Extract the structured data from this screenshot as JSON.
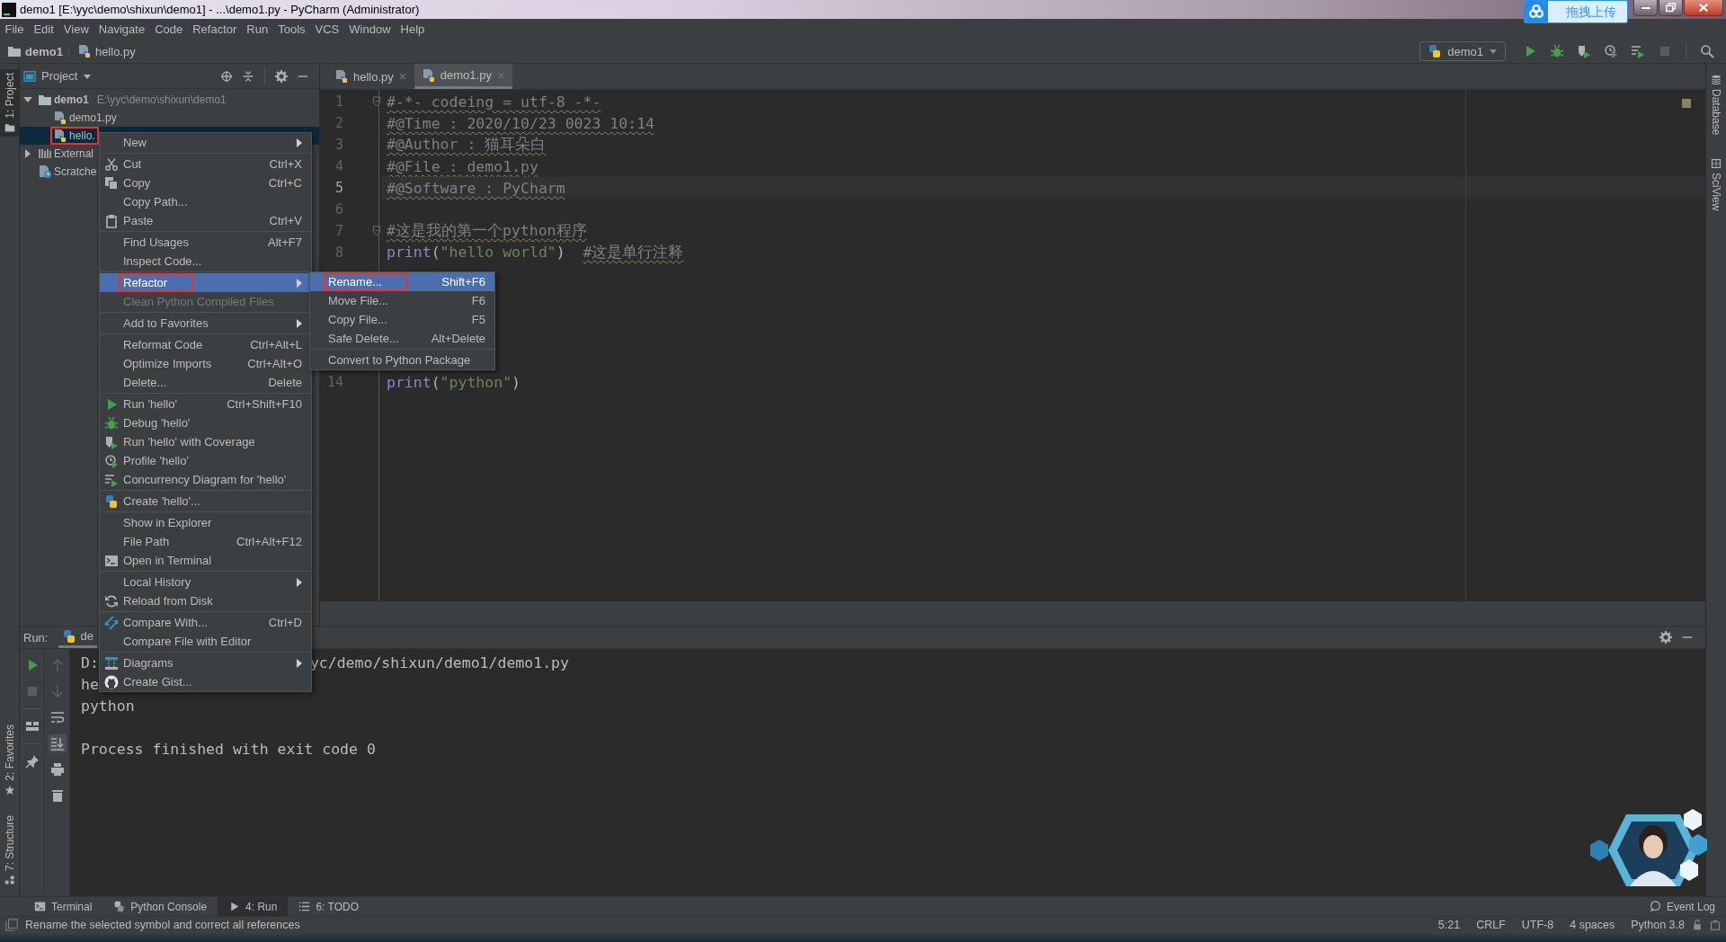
{
  "window": {
    "title": "demo1 [E:\\yyc\\demo\\shixun\\demo1] - ...\\demo1.py - PyCharm (Administrator)",
    "upload_widget": "拖拽上传"
  },
  "menu_bar": [
    "File",
    "Edit",
    "View",
    "Navigate",
    "Code",
    "Refactor",
    "Run",
    "Tools",
    "VCS",
    "Window",
    "Help"
  ],
  "breadcrumbs": [
    {
      "label": "demo1",
      "kind": "folder"
    },
    {
      "label": "hello.py",
      "kind": "python"
    }
  ],
  "run_config": "demo1",
  "left_stripe_top": [
    {
      "label": "1: Project",
      "selected": true
    }
  ],
  "left_stripe_bottom": [
    {
      "label": "2: Favorites",
      "selected": false
    },
    {
      "label": "7: Structure",
      "selected": false
    }
  ],
  "right_stripe": [
    "Database",
    "SciView"
  ],
  "project_panel": {
    "title": "Project",
    "tree": [
      {
        "label": "demo1",
        "path": "E:\\yyc\\demo\\shixun\\demo1",
        "kind": "folder",
        "expanded": true,
        "selected": false,
        "outlined": false,
        "children": [
          {
            "label": "demo1.py",
            "kind": "python",
            "selected": false,
            "outlined": false
          },
          {
            "label": "hello.",
            "kind": "python",
            "selected": true,
            "outlined": true
          }
        ]
      },
      {
        "label": "External",
        "kind": "library",
        "expanded": false,
        "selected": false,
        "outlined": false
      },
      {
        "label": "Scratche",
        "kind": "scratch",
        "selected": false,
        "outlined": false
      }
    ]
  },
  "editor": {
    "tabs": [
      {
        "label": "hello.py",
        "selected": false
      },
      {
        "label": "demo1.py",
        "selected": true
      }
    ],
    "lines": [
      {
        "number": "1",
        "kind": "code",
        "fold": true,
        "current": false,
        "tokens": [
          {
            "kind": "comment",
            "text": "#-*- codeing = utf-8 -*-"
          }
        ]
      },
      {
        "number": "2",
        "kind": "code",
        "fold": false,
        "current": false,
        "tokens": [
          {
            "kind": "comment",
            "text": "#@Time : 2020/10/23 0023 10:14"
          }
        ]
      },
      {
        "number": "3",
        "kind": "code",
        "fold": false,
        "current": false,
        "tokens": [
          {
            "kind": "comment",
            "text": "#@Author : 猫耳朵白"
          }
        ]
      },
      {
        "number": "4",
        "kind": "code",
        "fold": false,
        "current": false,
        "tokens": [
          {
            "kind": "comment",
            "text": "#@File : demo1.py"
          }
        ]
      },
      {
        "number": "5",
        "kind": "code",
        "fold": false,
        "current": true,
        "tokens": [
          {
            "kind": "comment",
            "text": "#@Software : PyCharm"
          }
        ]
      },
      {
        "number": "6",
        "kind": "blank",
        "fold": false,
        "current": false
      },
      {
        "number": "7",
        "kind": "code",
        "fold": true,
        "current": false,
        "tokens": [
          {
            "kind": "comment",
            "text": "#这是我的第一个python程序"
          }
        ]
      },
      {
        "number": "8",
        "kind": "code",
        "fold": false,
        "current": false,
        "tokens": [
          {
            "kind": "builtin",
            "text": "print"
          },
          {
            "kind": "paren",
            "text": "("
          },
          {
            "kind": "string",
            "text": "\"hello world\""
          },
          {
            "kind": "paren",
            "text": ")"
          },
          {
            "kind": "comment",
            "text": "#这是单行注释",
            "spaced": true
          }
        ]
      },
      {
        "kind": "covered"
      },
      {
        "kind": "covered"
      },
      {
        "kind": "covered"
      },
      {
        "kind": "covered"
      },
      {
        "kind": "covered"
      },
      {
        "number": "14",
        "kind": "code",
        "fold": false,
        "current": false,
        "tokens": [
          {
            "kind": "builtin",
            "text": "print"
          },
          {
            "kind": "paren",
            "text": "("
          },
          {
            "kind": "string",
            "text": "\"python\""
          },
          {
            "kind": "paren",
            "text": ")"
          }
        ]
      }
    ]
  },
  "run_panel": {
    "title": "Run:",
    "tab": "de",
    "console": [
      {
        "kind": "text",
        "text": "D:",
        "rest": "yc/demo/shixun/demo1/demo1.py"
      },
      {
        "kind": "text",
        "text": "he"
      },
      {
        "kind": "text",
        "text": "python"
      },
      {
        "kind": "blank"
      },
      {
        "kind": "text",
        "text": "Process finished with exit code 0"
      }
    ]
  },
  "bottom_tabs": [
    {
      "label": "Terminal",
      "selected": false
    },
    {
      "label": "Python Console",
      "selected": false
    },
    {
      "label": "4: Run",
      "selected": true
    },
    {
      "label": "6: TODO",
      "selected": false
    }
  ],
  "event_log": "Event Log",
  "status_bar": {
    "message": "Rename the selected symbol and correct all references",
    "items": [
      "5:21",
      "CRLF",
      "UTF-8",
      "4 spaces",
      "Python 3.8"
    ]
  },
  "context_menu": {
    "items": [
      {
        "kind": "item",
        "label": "New",
        "submenu": true,
        "selected": false,
        "disabled": false,
        "outlined": false
      },
      {
        "kind": "separator"
      },
      {
        "kind": "item",
        "label": "Cut",
        "shortcut": "Ctrl+X",
        "submenu": false,
        "selected": false,
        "disabled": false,
        "outlined": false
      },
      {
        "kind": "item",
        "label": "Copy",
        "shortcut": "Ctrl+C",
        "submenu": false,
        "selected": false,
        "disabled": false,
        "outlined": false
      },
      {
        "kind": "item",
        "label": "Copy Path...",
        "submenu": false,
        "selected": false,
        "disabled": false,
        "outlined": false
      },
      {
        "kind": "item",
        "label": "Paste",
        "shortcut": "Ctrl+V",
        "submenu": false,
        "selected": false,
        "disabled": false,
        "outlined": false
      },
      {
        "kind": "separator"
      },
      {
        "kind": "item",
        "label": "Find Usages",
        "shortcut": "Alt+F7",
        "submenu": false,
        "selected": false,
        "disabled": false,
        "outlined": false
      },
      {
        "kind": "item",
        "label": "Inspect Code...",
        "submenu": false,
        "selected": false,
        "disabled": false,
        "outlined": false
      },
      {
        "kind": "separator"
      },
      {
        "kind": "item",
        "label": "Refactor",
        "submenu": true,
        "selected": true,
        "disabled": false,
        "outlined": true
      },
      {
        "kind": "item",
        "label": "Clean Python Compiled Files",
        "submenu": false,
        "selected": false,
        "disabled": true,
        "outlined": false
      },
      {
        "kind": "separator"
      },
      {
        "kind": "item",
        "label": "Add to Favorites",
        "submenu": true,
        "selected": false,
        "disabled": false,
        "outlined": false
      },
      {
        "kind": "separator"
      },
      {
        "kind": "item",
        "label": "Reformat Code",
        "shortcut": "Ctrl+Alt+L",
        "submenu": false,
        "selected": false,
        "disabled": false,
        "outlined": false
      },
      {
        "kind": "item",
        "label": "Optimize Imports",
        "shortcut": "Ctrl+Alt+O",
        "submenu": false,
        "selected": false,
        "disabled": false,
        "outlined": false
      },
      {
        "kind": "item",
        "label": "Delete...",
        "shortcut": "Delete",
        "submenu": false,
        "selected": false,
        "disabled": false,
        "outlined": false
      },
      {
        "kind": "separator"
      },
      {
        "kind": "item",
        "label": "Run 'hello'",
        "shortcut": "Ctrl+Shift+F10",
        "submenu": false,
        "selected": false,
        "disabled": false,
        "outlined": false
      },
      {
        "kind": "item",
        "label": "Debug 'hello'",
        "submenu": false,
        "selected": false,
        "disabled": false,
        "outlined": false
      },
      {
        "kind": "item",
        "label": "Run 'hello' with Coverage",
        "submenu": false,
        "selected": false,
        "disabled": false,
        "outlined": false
      },
      {
        "kind": "item",
        "label": "Profile 'hello'",
        "submenu": false,
        "selected": false,
        "disabled": false,
        "outlined": false
      },
      {
        "kind": "item",
        "label": "Concurrency Diagram for 'hello'",
        "submenu": false,
        "selected": false,
        "disabled": false,
        "outlined": false
      },
      {
        "kind": "separator"
      },
      {
        "kind": "item",
        "label": "Create 'hello'...",
        "submenu": false,
        "selected": false,
        "disabled": false,
        "outlined": false
      },
      {
        "kind": "separator"
      },
      {
        "kind": "item",
        "label": "Show in Explorer",
        "submenu": false,
        "selected": false,
        "disabled": false,
        "outlined": false
      },
      {
        "kind": "item",
        "label": "File Path",
        "shortcut": "Ctrl+Alt+F12",
        "submenu": false,
        "selected": false,
        "disabled": false,
        "outlined": false
      },
      {
        "kind": "item",
        "label": "Open in Terminal",
        "submenu": false,
        "selected": false,
        "disabled": false,
        "outlined": false
      },
      {
        "kind": "separator"
      },
      {
        "kind": "item",
        "label": "Local History",
        "submenu": true,
        "selected": false,
        "disabled": false,
        "outlined": false
      },
      {
        "kind": "item",
        "label": "Reload from Disk",
        "submenu": false,
        "selected": false,
        "disabled": false,
        "outlined": false
      },
      {
        "kind": "separator"
      },
      {
        "kind": "item",
        "label": "Compare With...",
        "shortcut": "Ctrl+D",
        "submenu": false,
        "selected": false,
        "disabled": false,
        "outlined": false
      },
      {
        "kind": "item",
        "label": "Compare File with Editor",
        "submenu": false,
        "selected": false,
        "disabled": false,
        "outlined": false
      },
      {
        "kind": "separator"
      },
      {
        "kind": "item",
        "label": "Diagrams",
        "submenu": true,
        "selected": false,
        "disabled": false,
        "outlined": false
      },
      {
        "kind": "item",
        "label": "Create Gist...",
        "submenu": false,
        "selected": false,
        "disabled": false,
        "outlined": false
      }
    ]
  },
  "submenu": {
    "items": [
      {
        "kind": "item",
        "label": "Rename...",
        "shortcut": "Shift+F6",
        "submenu": false,
        "selected": true,
        "disabled": false,
        "outlined": true
      },
      {
        "kind": "item",
        "label": "Move File...",
        "shortcut": "F6",
        "submenu": false,
        "selected": false,
        "disabled": false,
        "outlined": false
      },
      {
        "kind": "item",
        "label": "Copy File...",
        "shortcut": "F5",
        "submenu": false,
        "selected": false,
        "disabled": false,
        "outlined": false
      },
      {
        "kind": "item",
        "label": "Safe Delete...",
        "shortcut": "Alt+Delete",
        "submenu": false,
        "selected": false,
        "disabled": false,
        "outlined": false
      },
      {
        "kind": "separator"
      },
      {
        "kind": "item",
        "label": "Convert to Python Package",
        "submenu": false,
        "selected": false,
        "disabled": false,
        "outlined": false
      }
    ]
  },
  "overlay": {
    "kind": "picture"
  }
}
